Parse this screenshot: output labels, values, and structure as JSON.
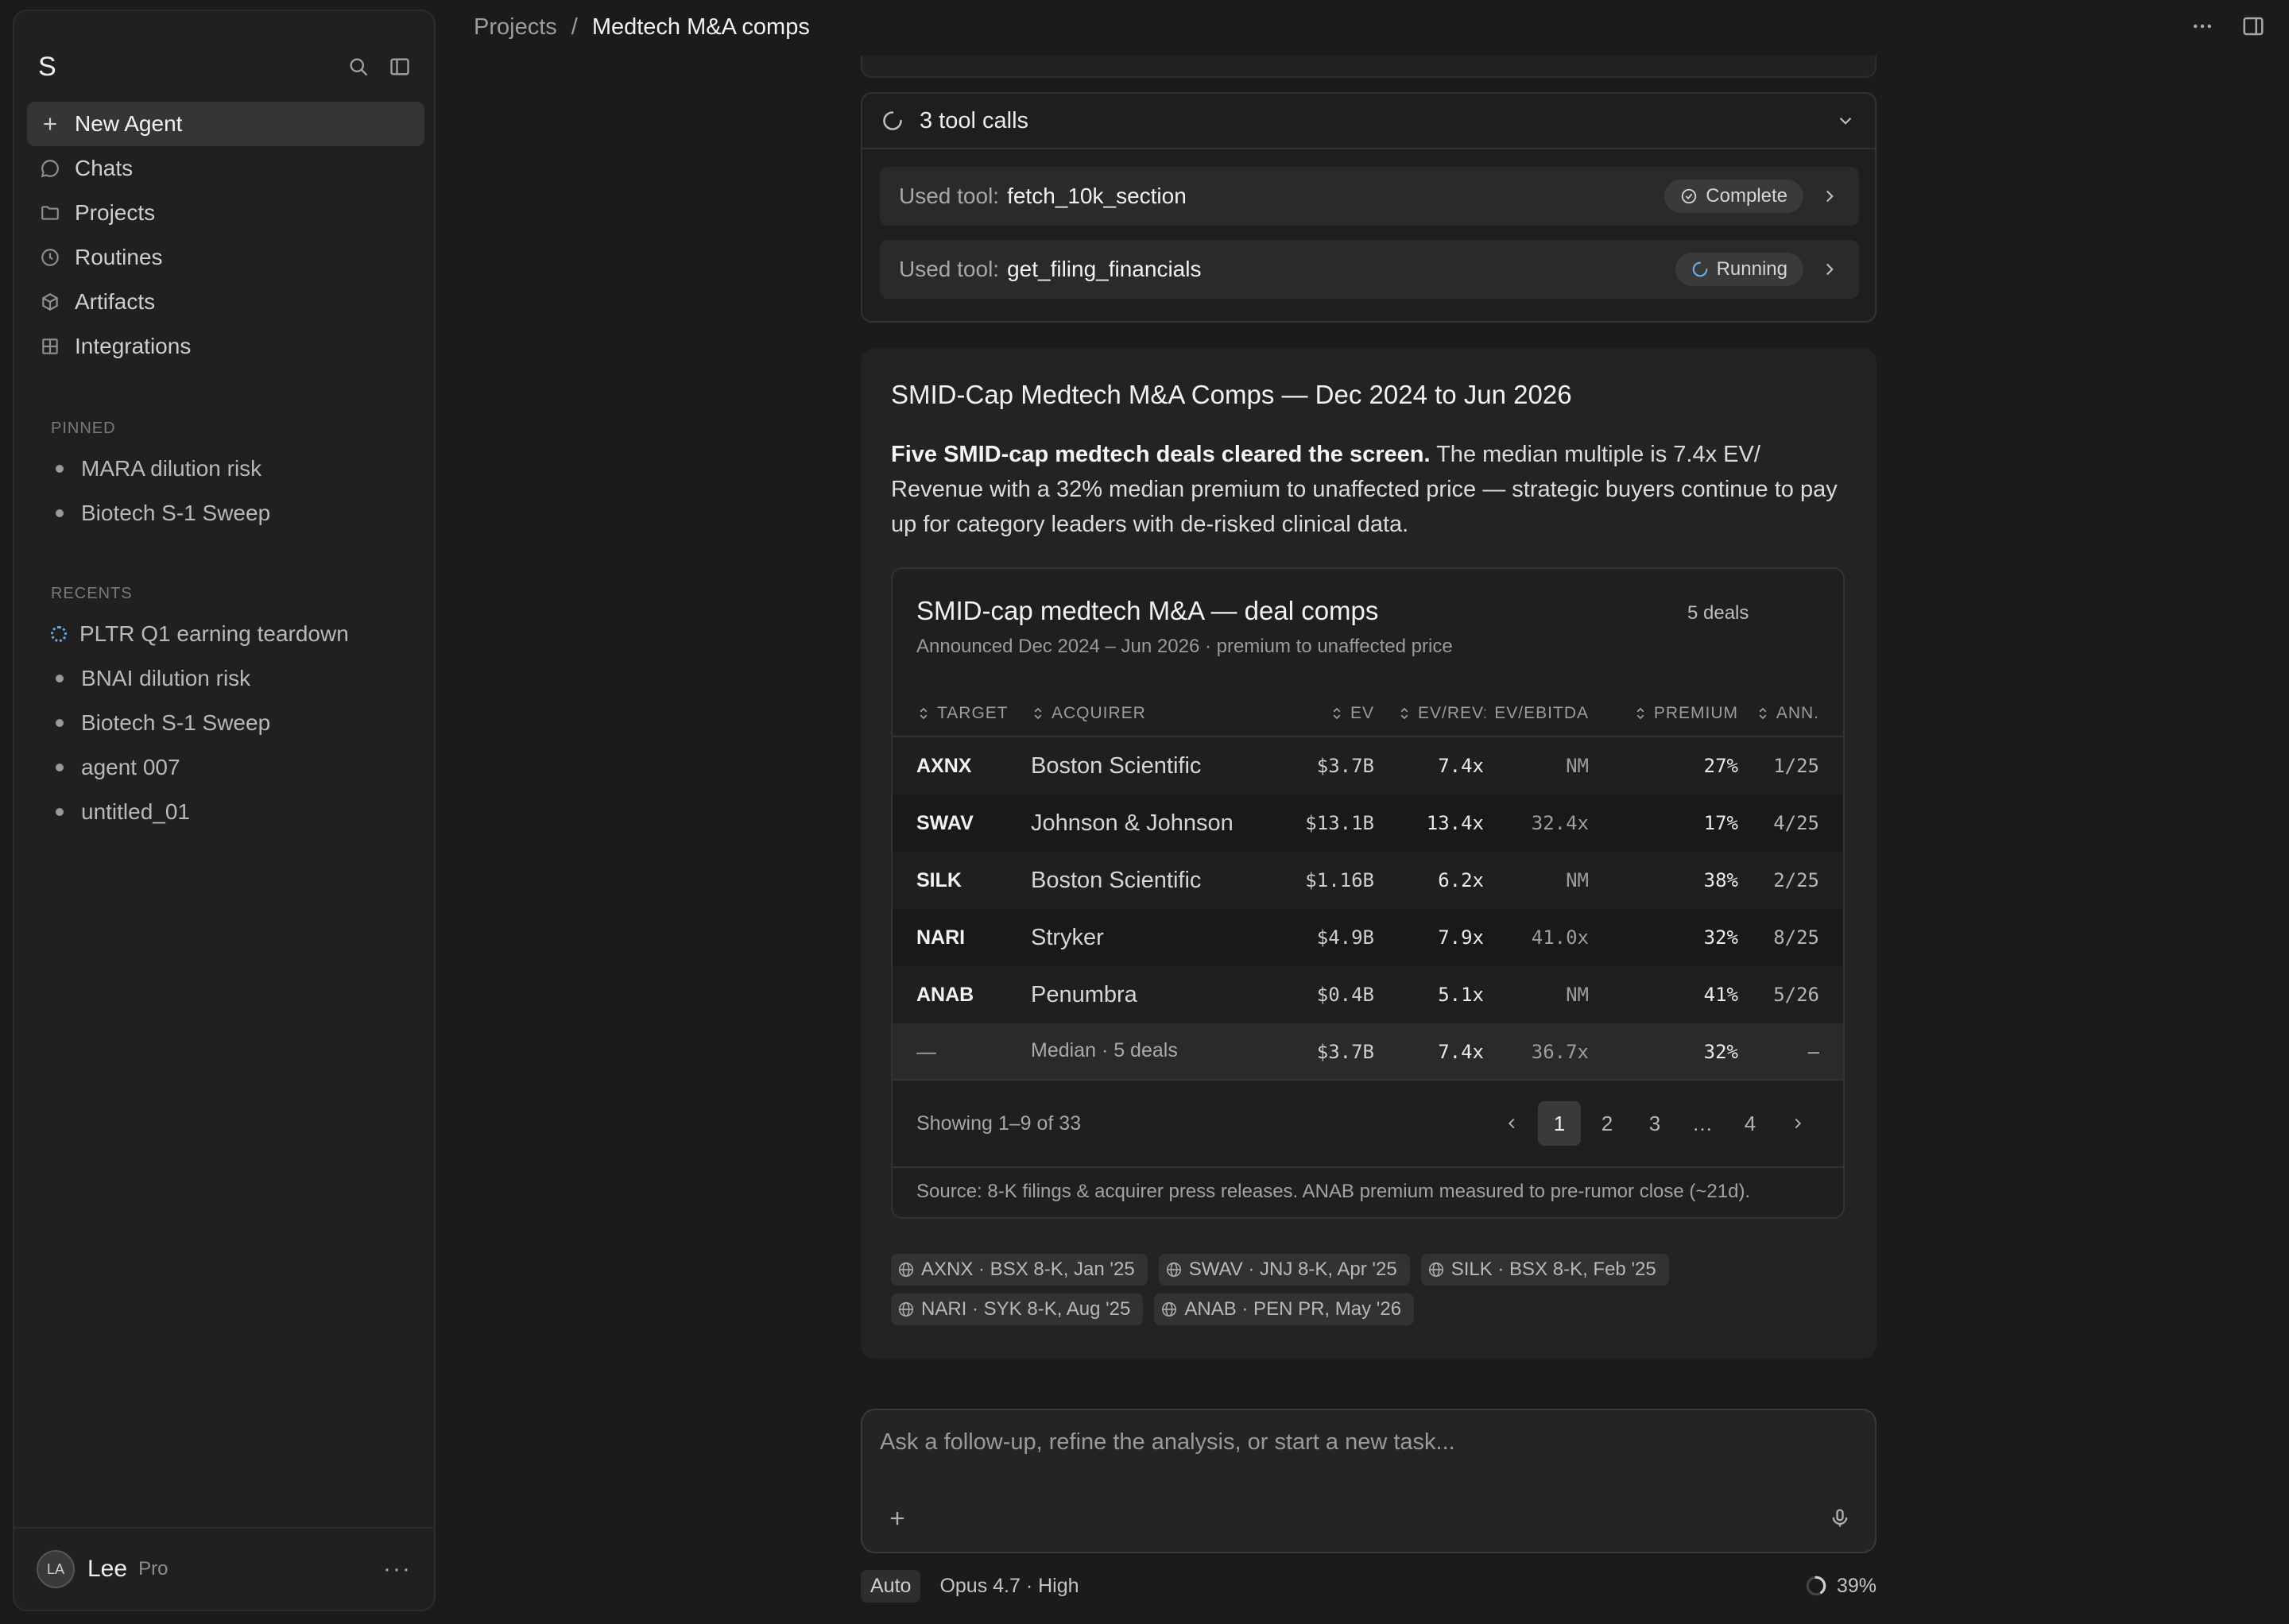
{
  "sidebar": {
    "logo": "S",
    "nav": [
      {
        "label": "New Agent",
        "icon": "plus-icon"
      },
      {
        "label": "Chats",
        "icon": "chat-icon"
      },
      {
        "label": "Projects",
        "icon": "folder-icon"
      },
      {
        "label": "Routines",
        "icon": "clock-icon"
      },
      {
        "label": "Artifacts",
        "icon": "cube-icon"
      },
      {
        "label": "Integrations",
        "icon": "grid-icon"
      }
    ],
    "pinned_label": "PINNED",
    "pinned": [
      "MARA dilution risk",
      "Biotech S-1 Sweep"
    ],
    "recents_label": "RECENTS",
    "recents": [
      "PLTR Q1 earning teardown",
      "BNAI dilution risk",
      "Biotech S-1 Sweep",
      "agent 007",
      "untitled_01"
    ],
    "user": {
      "initials": "LA",
      "name": "Lee",
      "plan": "Pro"
    }
  },
  "breadcrumb": {
    "parent": "Projects",
    "separator": "/",
    "current": "Medtech M&A comps"
  },
  "tools": {
    "header": "3 tool calls",
    "calls": [
      {
        "prefix": "Used tool:",
        "name": "fetch_10k_section",
        "status": "Complete"
      },
      {
        "prefix": "Used tool:",
        "name": "get_filing_financials",
        "status": "Running"
      }
    ]
  },
  "answer": {
    "title": "SMID-Cap Medtech M&A Comps — Dec 2024 to Jun 2026",
    "lead": "Five SMID-cap medtech deals cleared the screen.",
    "body": " The median multiple is 7.4x EV/ Revenue with a 32% median premium to unaffected price — strategic buyers continue to pay up for category leaders with de-risked clinical data."
  },
  "table": {
    "title": "SMID-cap medtech M&A — deal comps",
    "subtitle": "Announced Dec 2024 – Jun 2026 · premium to unaffected price",
    "count": "5 deals",
    "headers": {
      "target": "TARGET",
      "acquirer": "ACQUIRER",
      "ev": "EV",
      "evrev": "EV/REV",
      "evebitda": "EV/EBITDA",
      "premium": "PREMIUM",
      "ann": "ANN."
    },
    "rows": [
      {
        "target": "AXNX",
        "acquirer": "Boston Scientific",
        "ev": "$3.7B",
        "evrev": "7.4x",
        "evebitda": "NM",
        "premium": "27%",
        "ann": "1/25"
      },
      {
        "target": "SWAV",
        "acquirer": "Johnson & Johnson",
        "ev": "$13.1B",
        "evrev": "13.4x",
        "evebitda": "32.4x",
        "premium": "17%",
        "ann": "4/25"
      },
      {
        "target": "SILK",
        "acquirer": "Boston Scientific",
        "ev": "$1.16B",
        "evrev": "6.2x",
        "evebitda": "NM",
        "premium": "38%",
        "ann": "2/25"
      },
      {
        "target": "NARI",
        "acquirer": "Stryker",
        "ev": "$4.9B",
        "evrev": "7.9x",
        "evebitda": "41.0x",
        "premium": "32%",
        "ann": "8/25"
      },
      {
        "target": "ANAB",
        "acquirer": "Penumbra",
        "ev": "$0.4B",
        "evrev": "5.1x",
        "evebitda": "NM",
        "premium": "41%",
        "ann": "5/26"
      }
    ],
    "median": {
      "target": "—",
      "acquirer": "Median · 5 deals",
      "ev": "$3.7B",
      "evrev": "7.4x",
      "evebitda": "36.7x",
      "premium": "32%",
      "ann": "–"
    },
    "pagination": {
      "text": "Showing 1–9 of 33",
      "pages": [
        "1",
        "2",
        "3",
        "…",
        "4"
      ],
      "active": "1"
    },
    "source": "Source: 8-K filings & acquirer press releases. ANAB premium measured to pre-rumor close (~21d)."
  },
  "citations": [
    "AXNX · BSX 8-K, Jan '25",
    "SWAV · JNJ 8-K, Apr '25",
    "SILK · BSX 8-K, Feb '25",
    "NARI · SYK 8-K, Aug '25",
    "ANAB · PEN PR, May '26"
  ],
  "composer": {
    "placeholder": "Ask a follow-up, refine the analysis, or start a new task..."
  },
  "status": {
    "mode": "Auto",
    "model": "Opus 4.7 · High",
    "context": "39%"
  },
  "colors": {
    "background": "#1b1b1b",
    "sidebar": "#202020",
    "card": "#232323",
    "accent_spinner": "#6ea8e0"
  }
}
